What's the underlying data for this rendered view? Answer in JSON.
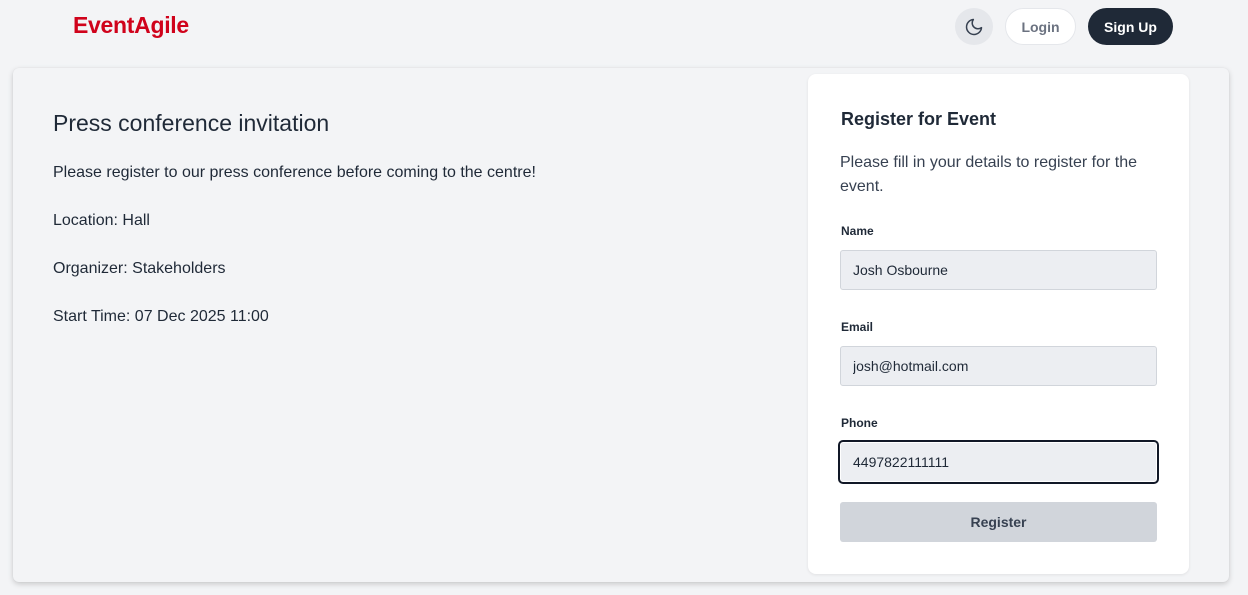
{
  "header": {
    "brand": "EventAgile",
    "theme_icon": "moon-icon",
    "login_label": "Login",
    "signup_label": "Sign Up"
  },
  "event": {
    "title": "Press conference invitation",
    "description": "Please register to our press conference before coming to the centre!",
    "location": "Location: Hall",
    "organizer": "Organizer: Stakeholders",
    "start_time": "Start Time: 07 Dec 2025 11:00"
  },
  "registration": {
    "title": "Register for Event",
    "description": "Please fill in your details to register for the event.",
    "name_label": "Name",
    "name_value": "Josh Osbourne",
    "email_label": "Email",
    "email_value": "josh@hotmail.com",
    "phone_label": "Phone",
    "phone_value": "4497822111111",
    "submit_label": "Register"
  },
  "colors": {
    "brand": "#d0021b",
    "primary_dark": "#1f2937",
    "background": "#f3f4f6"
  }
}
